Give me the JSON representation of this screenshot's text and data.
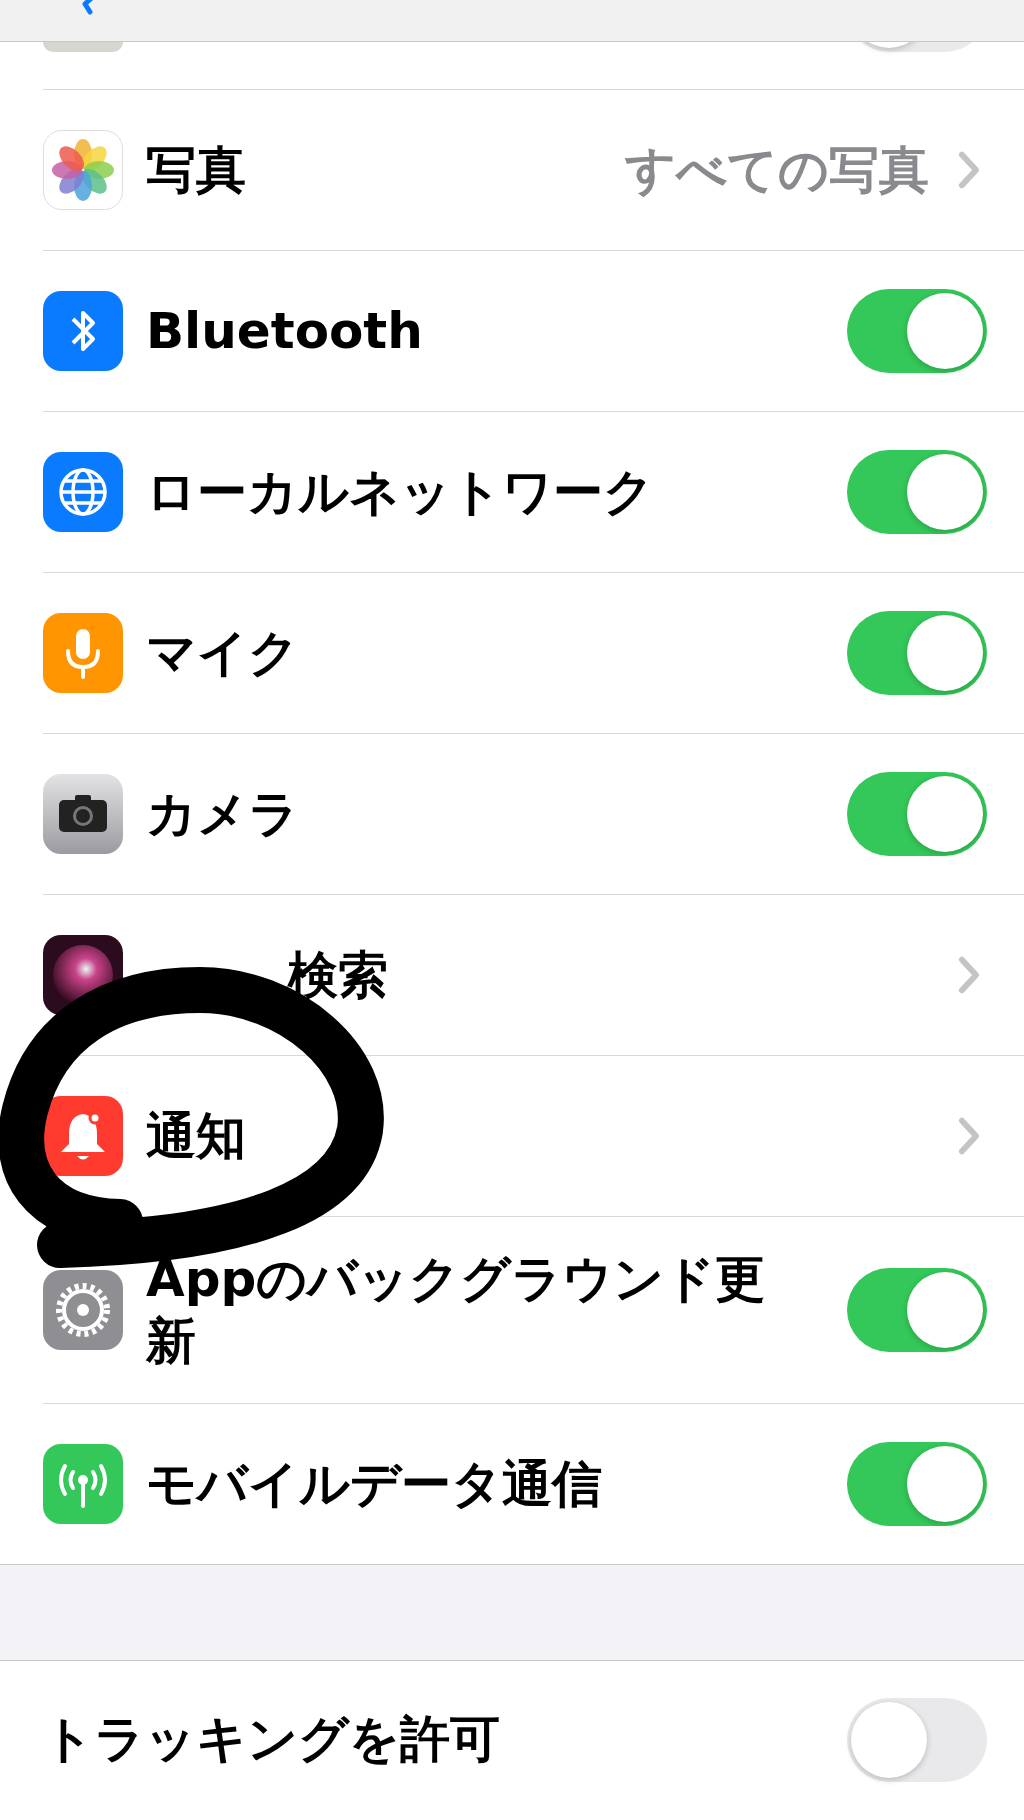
{
  "top_row": {
    "on": false
  },
  "rows": [
    {
      "kind": "value",
      "label": "写真",
      "value": "すべての写真"
    },
    {
      "kind": "toggle",
      "label": "Bluetooth",
      "on": true
    },
    {
      "kind": "toggle",
      "label": "ローカルネットワーク",
      "on": true
    },
    {
      "kind": "toggle",
      "label": "マイク",
      "on": true
    },
    {
      "kind": "toggle",
      "label": "カメラ",
      "on": true
    },
    {
      "kind": "chevron",
      "label": "検索",
      "obscured": true
    },
    {
      "kind": "chevron",
      "label": "通知",
      "obscured": false
    },
    {
      "kind": "toggle",
      "label": "Appのバックグラウンド更新",
      "on": true
    },
    {
      "kind": "toggle",
      "label": "モバイルデータ通信",
      "on": true
    }
  ],
  "tracking": {
    "label": "トラッキングを許可",
    "on": false
  }
}
